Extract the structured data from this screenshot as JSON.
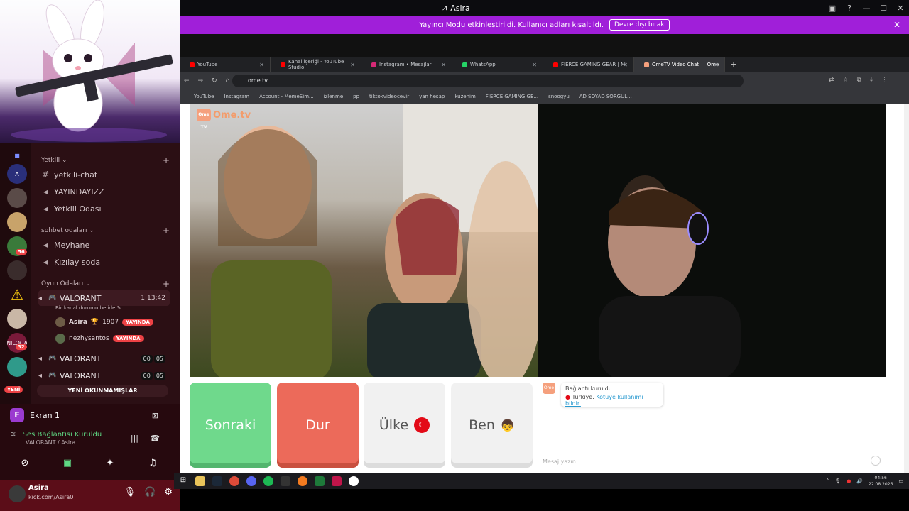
{
  "window": {
    "title": "Asira"
  },
  "stream_notice": {
    "text": "Yayıncı Modu etkinleştirildi. Kullanıcı adları kısaltıldı.",
    "button": "Devre dışı bırak"
  },
  "browser": {
    "tabs": [
      {
        "label": "YouTube",
        "color": "#ff0000"
      },
      {
        "label": "Kanal içeriği - YouTube Studio",
        "color": "#ff0000"
      },
      {
        "label": "Instagram • Mesajlar",
        "color": "#d62976"
      },
      {
        "label": "WhatsApp",
        "color": "#25d366"
      },
      {
        "label": "FIERCE GAMING GEAR | Mi",
        "color": "#ff0000"
      },
      {
        "label": "OmeTV Video Chat — Ome",
        "color": "#f5a07d"
      }
    ],
    "url": "ome.tv",
    "bookmarks": [
      "YouTube",
      "Instagram",
      "Account - MemeSim...",
      "izlenme",
      "pp",
      "tiktokvideocevir",
      "yan hesap",
      "kuzenim",
      "FIERCE GAMING GE...",
      "snoogyu",
      "AD SOYAD SORGUL..."
    ]
  },
  "ometv": {
    "logo": "Ome.tv",
    "logo_badge": "Ome TV",
    "buttons": {
      "next": "Sonraki",
      "stop": "Dur",
      "country": "Ülke",
      "me": "Ben"
    },
    "chat": {
      "status": "Bağlantı kuruldu",
      "country": "Türkiye.",
      "report": "Kötüye kullanımı bildir.",
      "placeholder": "Mesaj yazın"
    }
  },
  "discord": {
    "categories": [
      "Yetkili",
      "sohbet odaları",
      "Oyun Odaları"
    ],
    "text_channels": [
      "yetkili-chat",
      "YAYINDAYIZZ",
      "Yetkili Odası",
      "Meyhane",
      "Kızılay soda"
    ],
    "voice": {
      "name": "VALORANT",
      "timer": "1:13:42",
      "status": "Bir kanal durumu belirle",
      "users": [
        {
          "name": "Asira",
          "extra": "1907",
          "badge": "YAYINDA"
        },
        {
          "name": "nezhysantos",
          "badge": "YAYINDA"
        }
      ]
    },
    "other_voice": [
      {
        "name": "VALORANT",
        "c1": "00",
        "c2": "05"
      },
      {
        "name": "VALORANT",
        "c1": "00",
        "c2": "05"
      }
    ],
    "new_unread": "YENİ OKUNMAMIŞLAR",
    "new_badge": "YENİ",
    "guild_badges": {
      "g1": "56",
      "g2": "32"
    },
    "guild_label": "NILOCA",
    "screen": {
      "letter": "F",
      "label": "Ekran 1"
    },
    "connection": {
      "status": "Ses Bağlantısı Kuruldu",
      "channel": "VALORANT / Asira"
    },
    "user": {
      "name": "Asira",
      "status": "kick.com/Asira0"
    }
  },
  "taskbar": {
    "time": "04:56",
    "date": "22.08.2026"
  }
}
